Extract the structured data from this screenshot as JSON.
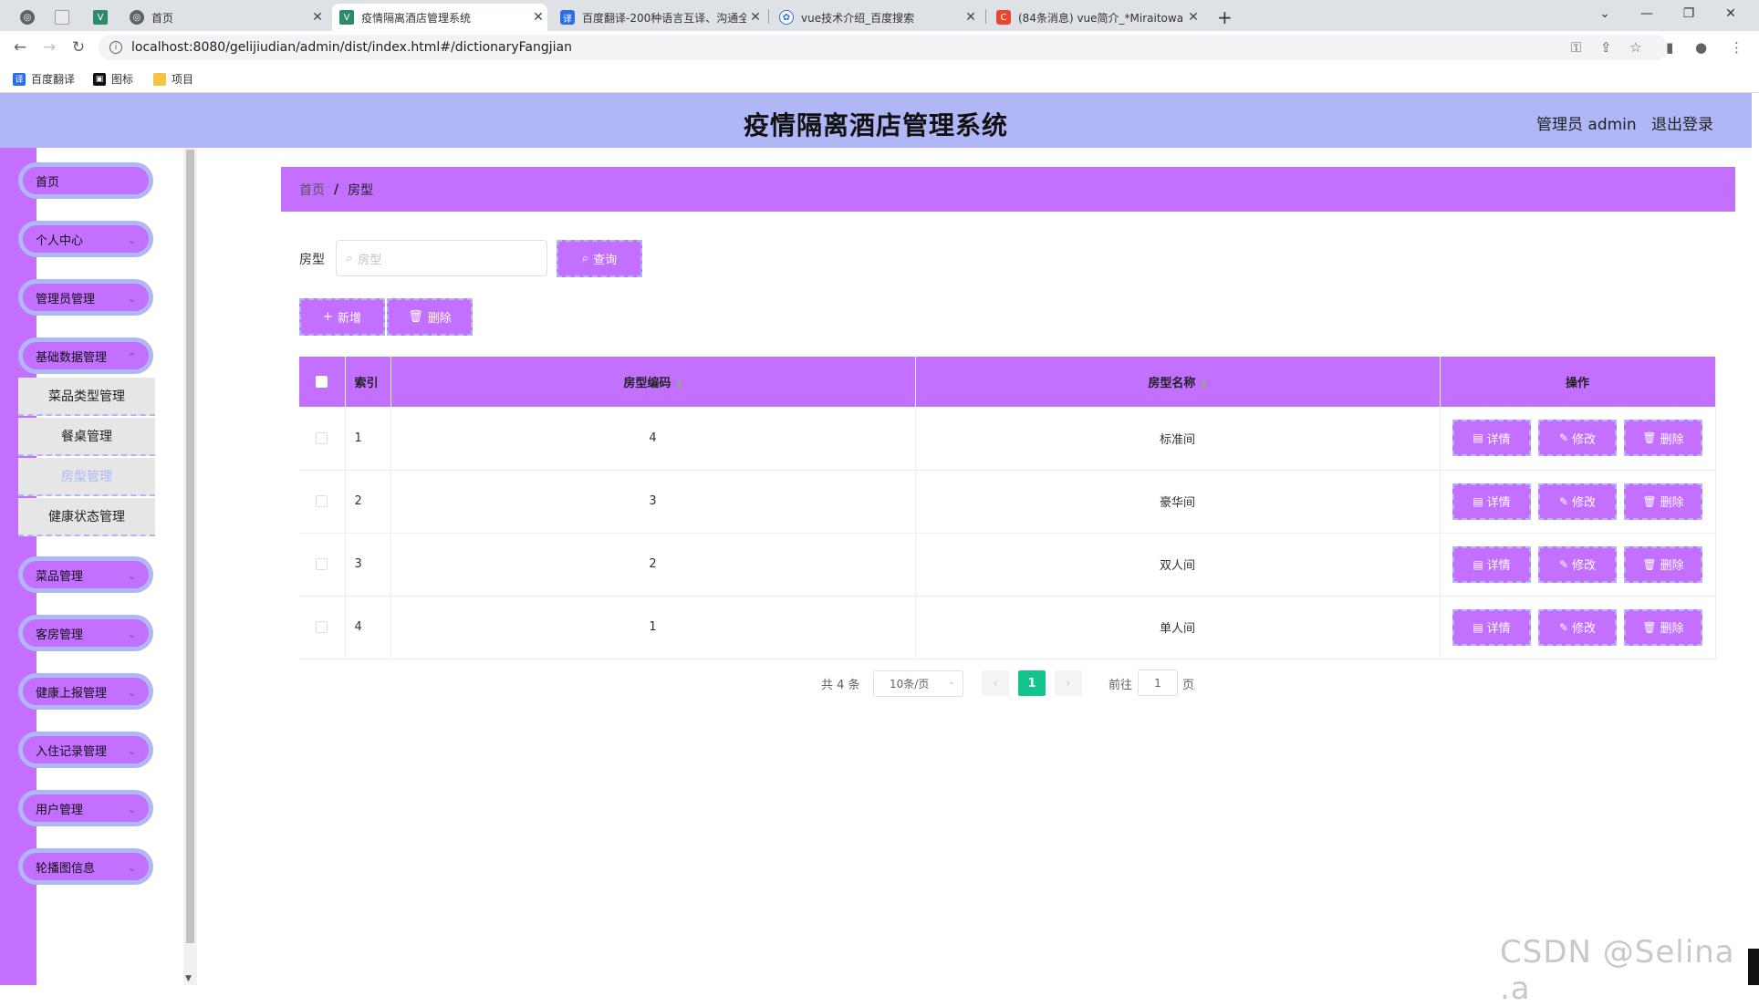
{
  "browser": {
    "tabs": [
      {
        "title": "",
        "icon": "globe-icon"
      },
      {
        "title": "",
        "icon": "blank-page-icon"
      },
      {
        "title": "",
        "icon": "vue-icon"
      },
      {
        "title": "首页",
        "icon": "globe-icon"
      },
      {
        "title": "疫情隔离酒店管理系统",
        "icon": "vue-icon"
      },
      {
        "title": "百度翻译-200种语言互译、沟通全",
        "icon": "baidu-translate-icon"
      },
      {
        "title": "vue技术介绍_百度搜索",
        "icon": "baidu-paw-icon"
      },
      {
        "title": "(84条消息) vue简介_*Miraitowa",
        "icon": "csdn-icon"
      }
    ],
    "url": "localhost:8080/gelijiudian/admin/dist/index.html#/dictionaryFangjian",
    "bookmarks": [
      {
        "label": "百度翻译",
        "icon": "baidu-translate-icon"
      },
      {
        "label": "图标",
        "icon": "picture-icon"
      },
      {
        "label": "项目",
        "icon": "folder-icon"
      }
    ]
  },
  "header": {
    "title": "疫情隔离酒店管理系统",
    "user": "管理员 admin",
    "logout": "退出登录"
  },
  "sidebar": {
    "items": [
      {
        "label": "首页"
      },
      {
        "label": "个人中心"
      },
      {
        "label": "管理员管理"
      },
      {
        "label": "基础数据管理"
      },
      {
        "label": "菜品管理"
      },
      {
        "label": "客房管理"
      },
      {
        "label": "健康上报管理"
      },
      {
        "label": "入住记录管理"
      },
      {
        "label": "用户管理"
      },
      {
        "label": "轮播图信息"
      }
    ],
    "submenu": [
      {
        "label": "菜品类型管理"
      },
      {
        "label": "餐桌管理"
      },
      {
        "label": "房型管理",
        "active": true
      },
      {
        "label": "健康状态管理"
      }
    ]
  },
  "breadcrumb": {
    "home": "首页",
    "separator": "/",
    "current": "房型"
  },
  "search": {
    "label": "房型",
    "placeholder": "房型",
    "button": "查询"
  },
  "actions": {
    "add": "新增",
    "delete": "删除"
  },
  "table": {
    "columns": {
      "index": "索引",
      "code": "房型编码",
      "name": "房型名称",
      "ops": "操作"
    },
    "rows": [
      {
        "index": "1",
        "code": "4",
        "name": "标准间"
      },
      {
        "index": "2",
        "code": "3",
        "name": "豪华间"
      },
      {
        "index": "3",
        "code": "2",
        "name": "双人间"
      },
      {
        "index": "4",
        "code": "1",
        "name": "单人间"
      }
    ],
    "row_actions": {
      "detail": "详情",
      "edit": "修改",
      "delete": "删除"
    }
  },
  "pagination": {
    "total": "共 4 条",
    "page_size": "10条/页",
    "current_page": "1",
    "goto_label": "前往",
    "goto_value": "1",
    "page_suffix": "页"
  },
  "watermark": "CSDN @Selina .a",
  "colors": {
    "header": "#b0b7f7",
    "accent": "#c36fff",
    "pager_active": "#13c48e"
  }
}
